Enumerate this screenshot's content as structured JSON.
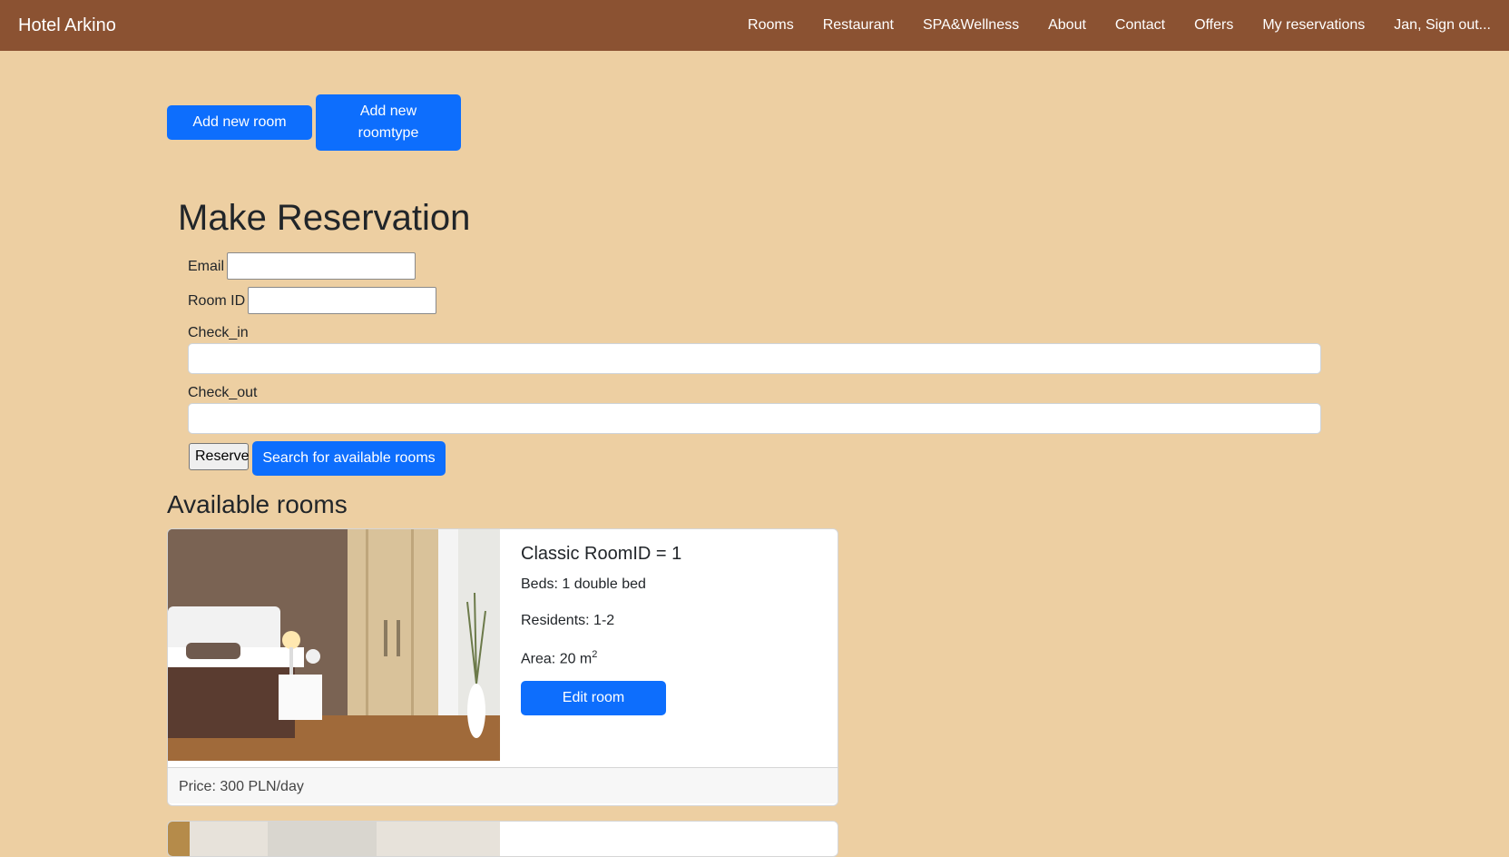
{
  "nav": {
    "brand": "Hotel Arkino",
    "links": [
      "Rooms",
      "Restaurant",
      "SPA&Wellness",
      "About",
      "Contact",
      "Offers",
      "My reservations",
      "Jan, Sign out..."
    ]
  },
  "admin": {
    "add_room": "Add new room",
    "add_roomtype": "Add new roomtype"
  },
  "reservation": {
    "title": "Make Reservation",
    "email_label": "Email",
    "room_id_label": "Room ID",
    "check_in_label": "Check_in",
    "check_out_label": "Check_out",
    "reserve_label": "Reserve",
    "search_label": "Search for available rooms"
  },
  "rooms": {
    "heading": "Available rooms",
    "items": [
      {
        "title": "Classic RoomID = 1",
        "beds": "Beds: 1 double bed",
        "residents": "Residents: 1-2",
        "area": "Area: 20 m",
        "area_sup": "2",
        "edit_label": "Edit room",
        "price": "Price: 300 PLN/day"
      }
    ]
  },
  "colors": {
    "navbar": "#8b5232",
    "background": "#edcfa2",
    "primary": "#0d6efd"
  }
}
